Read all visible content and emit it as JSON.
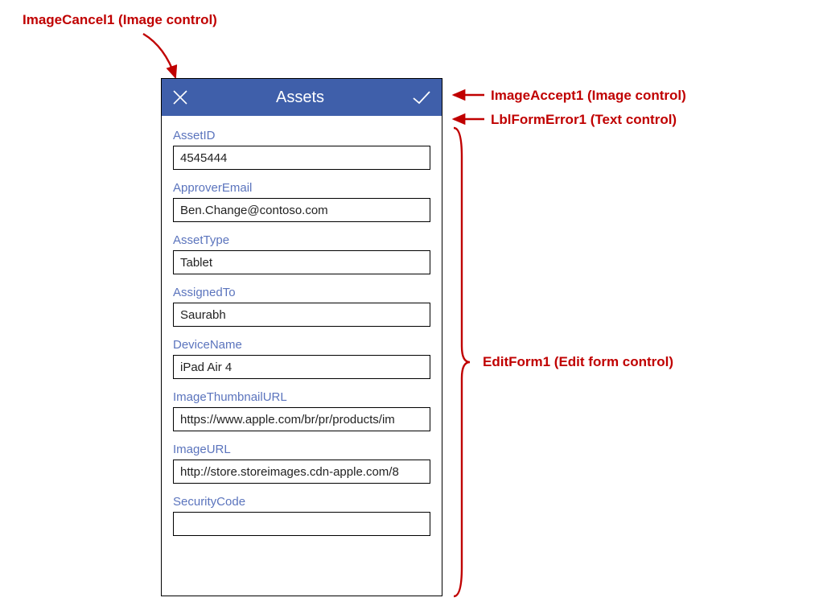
{
  "callouts": {
    "cancel": "ImageCancel1 (Image control)",
    "accept": "ImageAccept1 (Image control)",
    "error": "LblFormError1 (Text control)",
    "form": "EditForm1 (Edit form control)"
  },
  "header": {
    "title": "Assets"
  },
  "form": {
    "fields": [
      {
        "label": "AssetID",
        "value": "4545444"
      },
      {
        "label": "ApproverEmail",
        "value": "Ben.Change@contoso.com"
      },
      {
        "label": "AssetType",
        "value": "Tablet"
      },
      {
        "label": "AssignedTo",
        "value": "Saurabh"
      },
      {
        "label": "DeviceName",
        "value": "iPad Air 4"
      },
      {
        "label": "ImageThumbnailURL",
        "value": "https://www.apple.com/br/pr/products/im"
      },
      {
        "label": "ImageURL",
        "value": "http://store.storeimages.cdn-apple.com/8"
      },
      {
        "label": "SecurityCode",
        "value": ""
      }
    ]
  }
}
